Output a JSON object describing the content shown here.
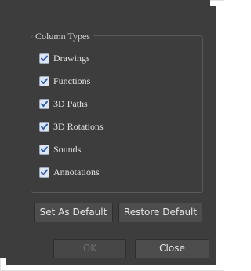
{
  "column_types": {
    "title": "Column Types",
    "items": [
      {
        "label": "Drawings",
        "checked": true
      },
      {
        "label": "Functions",
        "checked": true
      },
      {
        "label": "3D Paths",
        "checked": true
      },
      {
        "label": "3D Rotations",
        "checked": true
      },
      {
        "label": "Sounds",
        "checked": true
      },
      {
        "label": "Annotations",
        "checked": true
      }
    ]
  },
  "buttons": {
    "set_as_default": "Set As Default",
    "restore_default": "Restore Default",
    "ok": "OK",
    "close": "Close"
  },
  "colors": {
    "dialog_bg": "#3d3d3d",
    "checkbox_fill": "#dfe6f2",
    "checkmark": "#2a5fb3"
  }
}
